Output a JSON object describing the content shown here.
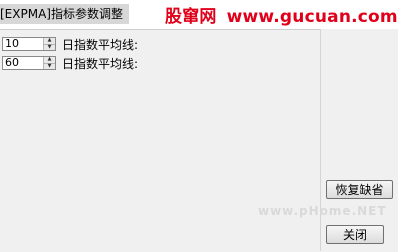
{
  "window": {
    "title": "[EXPMA]指标参数调整"
  },
  "brand": {
    "name": "股窜网",
    "site": "www.gucuan.com",
    "color": "#e0001a"
  },
  "params": [
    {
      "value": "10",
      "label": "日指数平均线:"
    },
    {
      "value": "60",
      "label": "日指数平均线:"
    }
  ],
  "buttons": {
    "restore_label": "恢复缺省",
    "close_label": "关闭"
  },
  "watermark": "www.pHome.NET"
}
